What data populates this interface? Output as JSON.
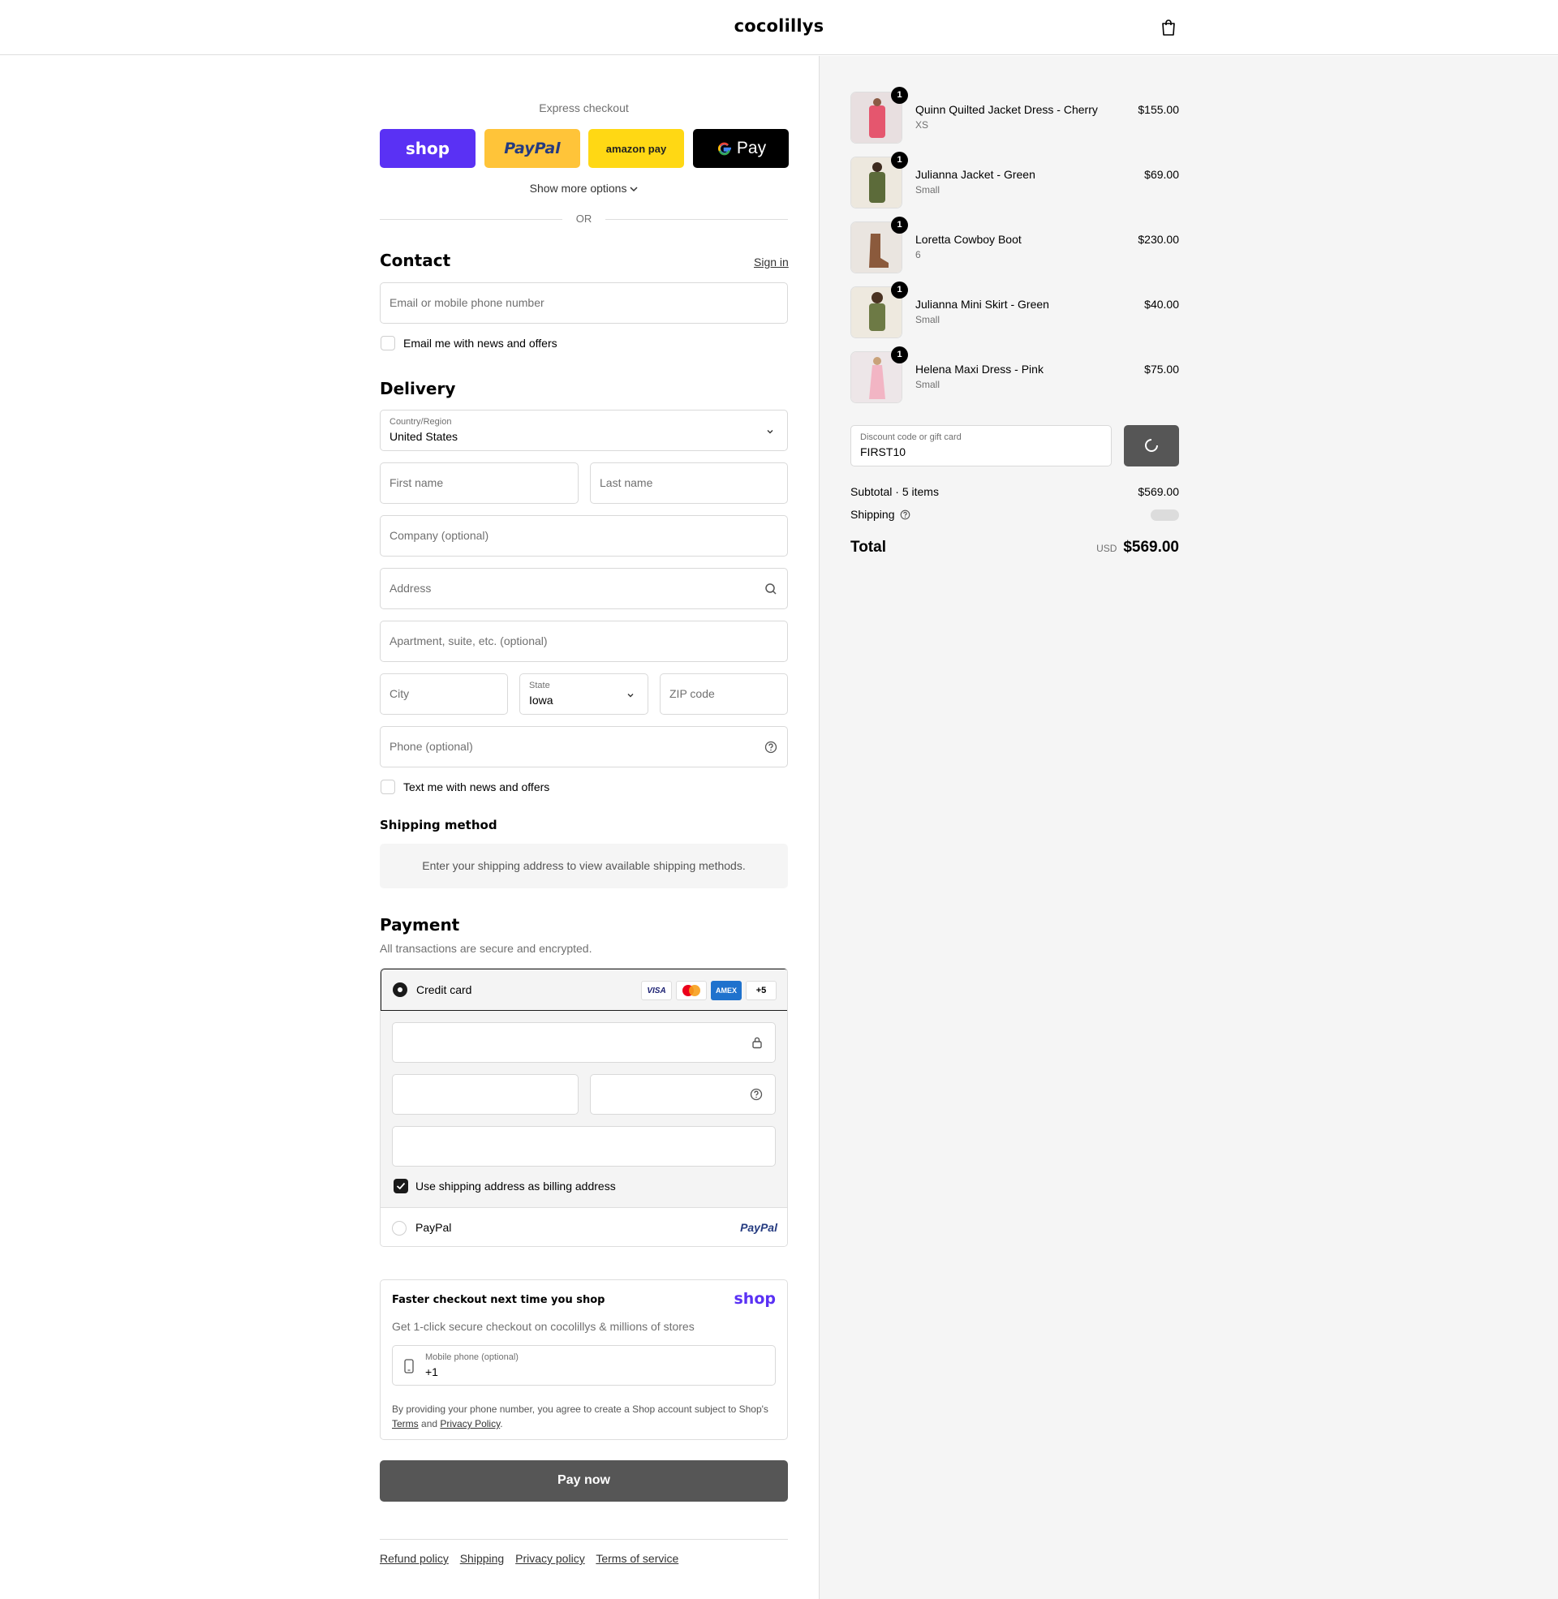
{
  "header": {
    "store_name": "cocolillys",
    "cart_icon": "shopping-bag-icon"
  },
  "express": {
    "label": "Express checkout",
    "shop_pay": "shop",
    "paypal": "PayPal",
    "amazon_pay": "amazon pay",
    "gpay": "Pay",
    "show_more": "Show more options",
    "or": "OR"
  },
  "contact": {
    "title": "Contact",
    "sign_in": "Sign in",
    "email_placeholder": "Email or mobile phone number",
    "news_checkbox": "Email me with news and offers"
  },
  "delivery": {
    "title": "Delivery",
    "country_label": "Country/Region",
    "country_value": "United States",
    "first_name": "First name",
    "last_name": "Last name",
    "company": "Company (optional)",
    "address": "Address",
    "apartment": "Apartment, suite, etc. (optional)",
    "city": "City",
    "state_label": "State",
    "state_value": "Iowa",
    "zip": "ZIP code",
    "phone": "Phone (optional)",
    "text_checkbox": "Text me with news and offers"
  },
  "shipping_method": {
    "title": "Shipping method",
    "message": "Enter your shipping address to view available shipping methods."
  },
  "payment": {
    "title": "Payment",
    "subtitle": "All transactions are secure and encrypted.",
    "credit_card": "Credit card",
    "card_brands": [
      "VISA",
      "Mastercard",
      "AMEX",
      "+5"
    ],
    "billing_checkbox": "Use shipping address as billing address",
    "paypal_option": "PayPal",
    "paypal_logo": "PayPal"
  },
  "shop_pay_card": {
    "title": "Faster checkout next time you shop",
    "logo": "shop",
    "subtitle": "Get 1-click secure checkout on cocolillys & millions of stores",
    "phone_label": "Mobile phone (optional)",
    "phone_value": "+1",
    "disclaimer_pre": "By providing your phone number, you agree to create a Shop account subject to Shop's",
    "terms": "Terms",
    "and": "and",
    "privacy": "Privacy Policy",
    "period": "."
  },
  "pay_now": "Pay now",
  "footer": [
    "Refund policy",
    "Shipping",
    "Privacy policy",
    "Terms of service"
  ],
  "order": {
    "items": [
      {
        "name": "Quinn Quilted Jacket Dress - Cherry",
        "variant": "XS",
        "price": "$155.00",
        "qty": "1"
      },
      {
        "name": "Julianna Jacket - Green",
        "variant": "Small",
        "price": "$69.00",
        "qty": "1"
      },
      {
        "name": "Loretta Cowboy Boot",
        "variant": "6",
        "price": "$230.00",
        "qty": "1"
      },
      {
        "name": "Julianna Mini Skirt - Green",
        "variant": "Small",
        "price": "$40.00",
        "qty": "1"
      },
      {
        "name": "Helena Maxi Dress - Pink",
        "variant": "Small",
        "price": "$75.00",
        "qty": "1"
      }
    ],
    "discount_label": "Discount code or gift card",
    "discount_value": "FIRST10",
    "subtotal_label": "Subtotal · 5 items",
    "subtotal_value": "$569.00",
    "shipping_label": "Shipping",
    "total_label": "Total",
    "currency": "USD",
    "total_value": "$569.00"
  },
  "colors": {
    "shop_purple": "#5a31f4",
    "paypal_yellow": "#ffc439",
    "amazon_yellow": "#ffd814",
    "pay_button": "#565656"
  }
}
